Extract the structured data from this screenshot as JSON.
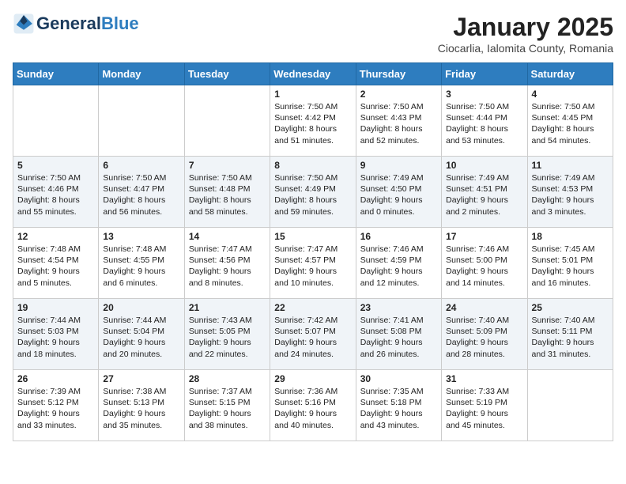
{
  "header": {
    "logo_general": "General",
    "logo_blue": "Blue",
    "month_title": "January 2025",
    "location": "Ciocarlia, Ialomita County, Romania"
  },
  "weekdays": [
    "Sunday",
    "Monday",
    "Tuesday",
    "Wednesday",
    "Thursday",
    "Friday",
    "Saturday"
  ],
  "weeks": [
    [
      {
        "day": "",
        "text": ""
      },
      {
        "day": "",
        "text": ""
      },
      {
        "day": "",
        "text": ""
      },
      {
        "day": "1",
        "text": "Sunrise: 7:50 AM\nSunset: 4:42 PM\nDaylight: 8 hours and 51 minutes."
      },
      {
        "day": "2",
        "text": "Sunrise: 7:50 AM\nSunset: 4:43 PM\nDaylight: 8 hours and 52 minutes."
      },
      {
        "day": "3",
        "text": "Sunrise: 7:50 AM\nSunset: 4:44 PM\nDaylight: 8 hours and 53 minutes."
      },
      {
        "day": "4",
        "text": "Sunrise: 7:50 AM\nSunset: 4:45 PM\nDaylight: 8 hours and 54 minutes."
      }
    ],
    [
      {
        "day": "5",
        "text": "Sunrise: 7:50 AM\nSunset: 4:46 PM\nDaylight: 8 hours and 55 minutes."
      },
      {
        "day": "6",
        "text": "Sunrise: 7:50 AM\nSunset: 4:47 PM\nDaylight: 8 hours and 56 minutes."
      },
      {
        "day": "7",
        "text": "Sunrise: 7:50 AM\nSunset: 4:48 PM\nDaylight: 8 hours and 58 minutes."
      },
      {
        "day": "8",
        "text": "Sunrise: 7:50 AM\nSunset: 4:49 PM\nDaylight: 8 hours and 59 minutes."
      },
      {
        "day": "9",
        "text": "Sunrise: 7:49 AM\nSunset: 4:50 PM\nDaylight: 9 hours and 0 minutes."
      },
      {
        "day": "10",
        "text": "Sunrise: 7:49 AM\nSunset: 4:51 PM\nDaylight: 9 hours and 2 minutes."
      },
      {
        "day": "11",
        "text": "Sunrise: 7:49 AM\nSunset: 4:53 PM\nDaylight: 9 hours and 3 minutes."
      }
    ],
    [
      {
        "day": "12",
        "text": "Sunrise: 7:48 AM\nSunset: 4:54 PM\nDaylight: 9 hours and 5 minutes."
      },
      {
        "day": "13",
        "text": "Sunrise: 7:48 AM\nSunset: 4:55 PM\nDaylight: 9 hours and 6 minutes."
      },
      {
        "day": "14",
        "text": "Sunrise: 7:47 AM\nSunset: 4:56 PM\nDaylight: 9 hours and 8 minutes."
      },
      {
        "day": "15",
        "text": "Sunrise: 7:47 AM\nSunset: 4:57 PM\nDaylight: 9 hours and 10 minutes."
      },
      {
        "day": "16",
        "text": "Sunrise: 7:46 AM\nSunset: 4:59 PM\nDaylight: 9 hours and 12 minutes."
      },
      {
        "day": "17",
        "text": "Sunrise: 7:46 AM\nSunset: 5:00 PM\nDaylight: 9 hours and 14 minutes."
      },
      {
        "day": "18",
        "text": "Sunrise: 7:45 AM\nSunset: 5:01 PM\nDaylight: 9 hours and 16 minutes."
      }
    ],
    [
      {
        "day": "19",
        "text": "Sunrise: 7:44 AM\nSunset: 5:03 PM\nDaylight: 9 hours and 18 minutes."
      },
      {
        "day": "20",
        "text": "Sunrise: 7:44 AM\nSunset: 5:04 PM\nDaylight: 9 hours and 20 minutes."
      },
      {
        "day": "21",
        "text": "Sunrise: 7:43 AM\nSunset: 5:05 PM\nDaylight: 9 hours and 22 minutes."
      },
      {
        "day": "22",
        "text": "Sunrise: 7:42 AM\nSunset: 5:07 PM\nDaylight: 9 hours and 24 minutes."
      },
      {
        "day": "23",
        "text": "Sunrise: 7:41 AM\nSunset: 5:08 PM\nDaylight: 9 hours and 26 minutes."
      },
      {
        "day": "24",
        "text": "Sunrise: 7:40 AM\nSunset: 5:09 PM\nDaylight: 9 hours and 28 minutes."
      },
      {
        "day": "25",
        "text": "Sunrise: 7:40 AM\nSunset: 5:11 PM\nDaylight: 9 hours and 31 minutes."
      }
    ],
    [
      {
        "day": "26",
        "text": "Sunrise: 7:39 AM\nSunset: 5:12 PM\nDaylight: 9 hours and 33 minutes."
      },
      {
        "day": "27",
        "text": "Sunrise: 7:38 AM\nSunset: 5:13 PM\nDaylight: 9 hours and 35 minutes."
      },
      {
        "day": "28",
        "text": "Sunrise: 7:37 AM\nSunset: 5:15 PM\nDaylight: 9 hours and 38 minutes."
      },
      {
        "day": "29",
        "text": "Sunrise: 7:36 AM\nSunset: 5:16 PM\nDaylight: 9 hours and 40 minutes."
      },
      {
        "day": "30",
        "text": "Sunrise: 7:35 AM\nSunset: 5:18 PM\nDaylight: 9 hours and 43 minutes."
      },
      {
        "day": "31",
        "text": "Sunrise: 7:33 AM\nSunset: 5:19 PM\nDaylight: 9 hours and 45 minutes."
      },
      {
        "day": "",
        "text": ""
      }
    ]
  ]
}
